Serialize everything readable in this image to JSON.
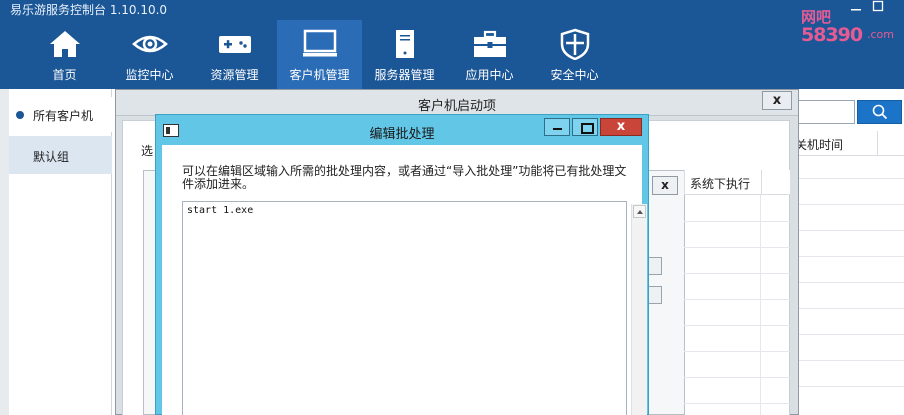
{
  "app": {
    "title": "易乐游服务控制台 1.10.10.0",
    "window_controls": [
      "□"
    ]
  },
  "nav": {
    "items": [
      {
        "label": "首页",
        "icon": "home-icon"
      },
      {
        "label": "监控中心",
        "icon": "eye-icon"
      },
      {
        "label": "资源管理",
        "icon": "gamepad-icon"
      },
      {
        "label": "客户机管理",
        "icon": "monitor-icon",
        "active": true
      },
      {
        "label": "服务器管理",
        "icon": "server-icon"
      },
      {
        "label": "应用中心",
        "icon": "toolbox-icon"
      },
      {
        "label": "安全中心",
        "icon": "shield-icon"
      }
    ]
  },
  "watermark": {
    "line1": "网吧",
    "line2": "58390",
    "line3": ".com"
  },
  "sidebar": {
    "items": [
      {
        "label": "所有客户机"
      },
      {
        "label": "默认组"
      }
    ]
  },
  "background_table": {
    "column_header": "关机时间"
  },
  "startup_dialog": {
    "title": "客户机启动项",
    "close_label": "x",
    "select_label": "选",
    "inner_close_label": "x",
    "column_header": "系统下执行"
  },
  "batch_dialog": {
    "title": "编辑批处理",
    "close_label": "x",
    "description": "可以在编辑区域输入所需的批处理内容，或者通过“导入批处理”功能将已有批处理文件添加进来。",
    "editor_content": "start 1.exe"
  },
  "colors": {
    "header_bg": "#1b5696",
    "nav_active": "#2a6cb5",
    "dialog_accent": "#62c6e6",
    "close_red": "#c9453a",
    "search_btn": "#1b74c8"
  }
}
